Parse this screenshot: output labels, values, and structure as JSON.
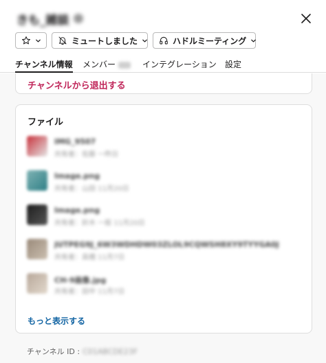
{
  "header": {
    "title": "きも_雑談",
    "close_icon": "close-icon"
  },
  "actions": {
    "star_icon": "star-outline-icon",
    "mute_label": "ミュートしました",
    "mute_icon": "bell-off-icon",
    "huddle_label": "ハドルミーティング",
    "huddle_icon": "headphones-icon"
  },
  "tabs": [
    {
      "label": "チャンネル情報",
      "active": true
    },
    {
      "label": "メンバー",
      "active": false
    },
    {
      "label": "インテグレーション",
      "active": false
    },
    {
      "label": "設定",
      "active": false
    }
  ],
  "leave": {
    "label": "チャンネルから退出する"
  },
  "files": {
    "title": "ファイル",
    "items": [
      {
        "name": "IMG_9507",
        "meta": "共有者：佐藤 一昨日",
        "thumb_colors": [
          "#c8323c",
          "#e5e5e5"
        ]
      },
      {
        "name": "Image.png",
        "meta": "共有者：山田 11月20日",
        "thumb_colors": [
          "#7fb3b4",
          "#2f7f86"
        ]
      },
      {
        "name": "Image.png",
        "meta": "共有者：鈴木 一般 11月20日",
        "thumb_colors": [
          "#1e1e1e",
          "#555555"
        ]
      },
      {
        "name": "JUTPEG9J_6W3WDHDW03ZLOL9CQWSH8XY9TYYGA0J",
        "meta": "共有者：高橋 11月7日",
        "thumb_colors": [
          "#9a8a7a",
          "#cbbfb0"
        ]
      },
      {
        "name": "CH-9画像.jpg",
        "meta": "共有者：田中 11月7日",
        "thumb_colors": [
          "#b8a89a",
          "#e2d8cc"
        ]
      }
    ],
    "more_label": "もっと表示する"
  },
  "footer": {
    "channel_id_label": "チャンネル ID :",
    "channel_id_value": "C01ABCDE23F"
  },
  "colors": {
    "danger": "#c0265a",
    "link": "#1264a3",
    "border": "#dddddd"
  }
}
